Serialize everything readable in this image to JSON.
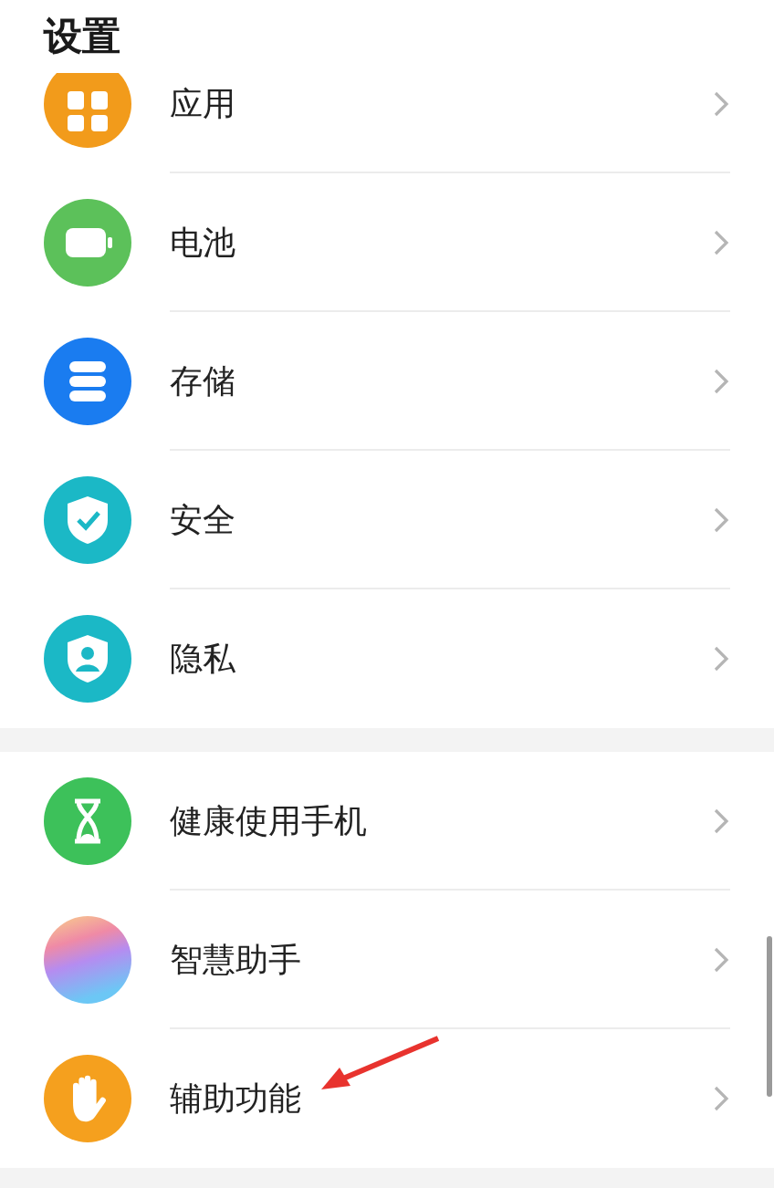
{
  "header": {
    "title": "设置"
  },
  "groups": [
    {
      "items": [
        {
          "label": "应用",
          "kind": "apps",
          "color": "#f29b1b",
          "pointed": false
        },
        {
          "label": "电池",
          "kind": "battery",
          "color": "#5cc15a",
          "pointed": false
        },
        {
          "label": "存储",
          "kind": "storage",
          "color": "#1a7cf0",
          "pointed": false
        },
        {
          "label": "安全",
          "kind": "shield-check",
          "color": "#1bb8c6",
          "pointed": false
        },
        {
          "label": "隐私",
          "kind": "shield-person",
          "color": "#1bb8c6",
          "pointed": false
        }
      ]
    },
    {
      "items": [
        {
          "label": "健康使用手机",
          "kind": "hourglass",
          "color": "#3dc15a",
          "pointed": false
        },
        {
          "label": "智慧助手",
          "kind": "gradient",
          "pointed": false
        },
        {
          "label": "辅助功能",
          "kind": "hand",
          "color": "#f5a01e",
          "pointed": true
        }
      ]
    }
  ]
}
